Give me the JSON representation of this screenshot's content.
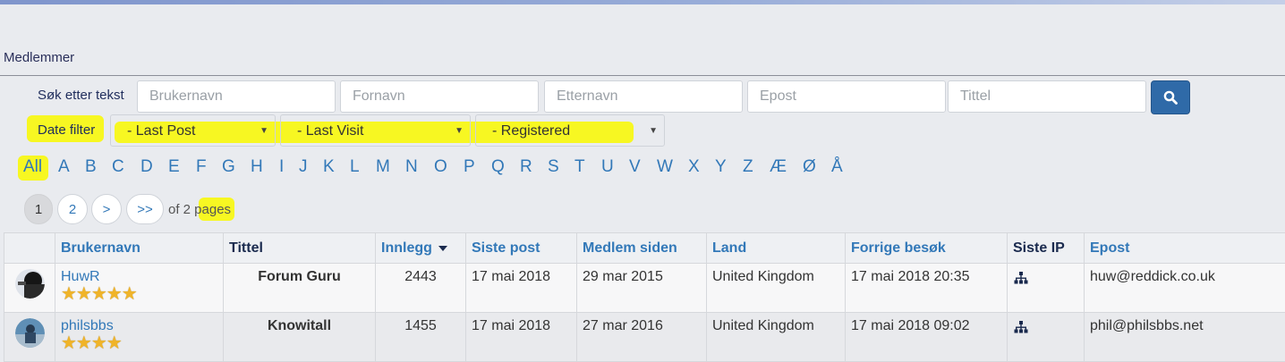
{
  "section_title": "Medlemmer",
  "search": {
    "label": "Søk etter tekst",
    "placeholders": {
      "username": "Brukernavn",
      "firstname": "Fornavn",
      "lastname": "Etternavn",
      "email": "Epost",
      "title": "Tittel"
    },
    "button_icon": "search-icon"
  },
  "date_filter": {
    "label": "Date filter",
    "last_post": "- Last Post",
    "last_visit": "- Last Visit",
    "registered": "- Registered",
    "caret": "▼"
  },
  "letters": [
    "All",
    "A",
    "B",
    "C",
    "D",
    "E",
    "F",
    "G",
    "H",
    "I",
    "J",
    "K",
    "L",
    "M",
    "N",
    "O",
    "P",
    "Q",
    "R",
    "S",
    "T",
    "U",
    "V",
    "W",
    "X",
    "Y",
    "Z",
    "Æ",
    "Ø",
    "Å"
  ],
  "pager": {
    "pages": [
      "1",
      "2"
    ],
    "next": ">",
    "last": ">>",
    "summary": "of 2 pages",
    "current": "1"
  },
  "table": {
    "headers": {
      "username": "Brukernavn",
      "title": "Tittel",
      "posts": "Innlegg",
      "last_post": "Siste post",
      "member_since": "Medlem siden",
      "country": "Land",
      "last_visit": "Forrige besøk",
      "last_ip": "Siste IP",
      "email": "Epost"
    },
    "rows": [
      {
        "username": "HuwR",
        "stars": "★★★★★",
        "title": "Forum Guru",
        "posts": "2443",
        "last_post": "17 mai 2018",
        "member_since": "29 mar 2015",
        "country": "United Kingdom",
        "last_visit": "17 mai 2018 20:35",
        "email": "huw@reddick.co.uk"
      },
      {
        "username": "philsbbs",
        "stars": "★★★★",
        "title": "Knowitall",
        "posts": "1455",
        "last_post": "17 mai 2018",
        "member_since": "27 mar 2016",
        "country": "United Kingdom",
        "last_visit": "17 mai 2018 09:02",
        "email": "phil@philsbbs.net"
      }
    ]
  },
  "colors": {
    "link": "#3278b8",
    "highlight": "#f7f722",
    "search_button": "#2f6aa8"
  }
}
